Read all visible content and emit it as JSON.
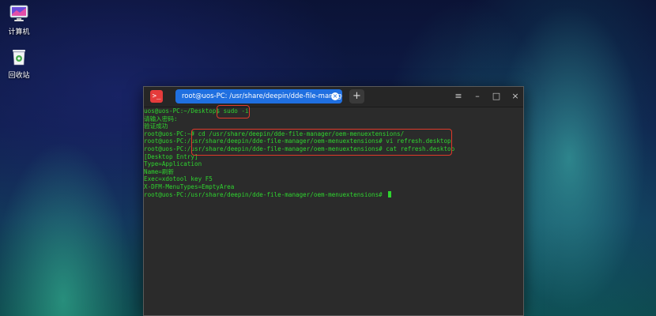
{
  "desktop": {
    "icons": [
      {
        "label": "计算机",
        "icon": "computer-icon"
      },
      {
        "label": "回收站",
        "icon": "trash-icon"
      }
    ]
  },
  "terminal": {
    "tab_title": "root@uos-PC: /usr/share/deepin/dde-file-manager/oem-me...",
    "add_tab": "+",
    "window_buttons": {
      "menu": "≡",
      "minimize": "–",
      "maximize": "□",
      "close": "×"
    },
    "lines": [
      "uos@uos-PC:~/Desktop$ sudo -i",
      "请输入密码:",
      "验证成功",
      "root@uos-PC:~# cd /usr/share/deepin/dde-file-manager/oem-menuextensions/",
      "root@uos-PC:/usr/share/deepin/dde-file-manager/oem-menuextensions# vi refresh.desktop",
      "root@uos-PC:/usr/share/deepin/dde-file-manager/oem-menuextensions# cat refresh.desktop",
      "[Desktop Entry]",
      "Type=Application",
      "Name=刷新",
      "Exec=xdotool key F5",
      "X-DFM-MenuTypes=EmptyArea",
      "root@uos-PC:/usr/share/deepin/dde-file-manager/oem-menuextensions# "
    ]
  },
  "colors": {
    "terminal_text": "#2fd52f",
    "tab_active": "#1f6fe0",
    "highlight_box": "#e03a2a"
  }
}
